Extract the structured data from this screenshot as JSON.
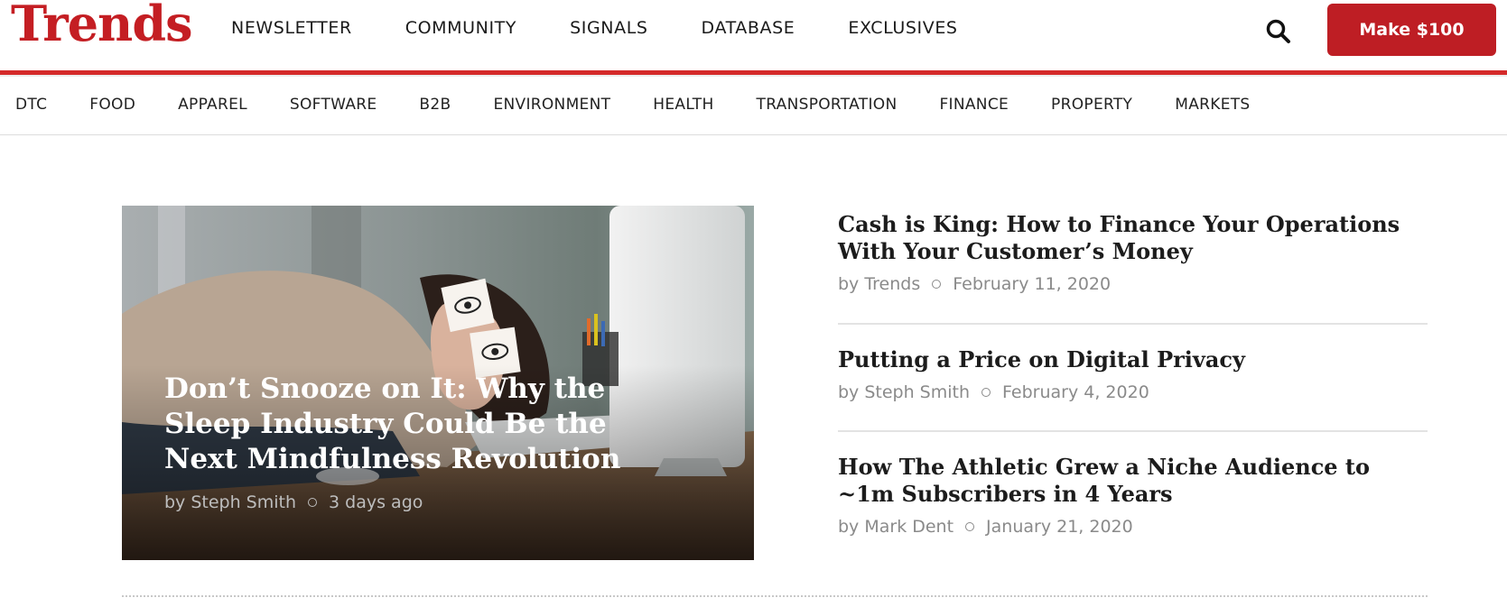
{
  "brand": {
    "name": "Trends",
    "color": "#c41e23"
  },
  "main_nav": [
    "NEWSLETTER",
    "COMMUNITY",
    "SIGNALS",
    "DATABASE",
    "EXCLUSIVES"
  ],
  "search": {
    "icon": "search-icon"
  },
  "cta": {
    "label": "Make $100",
    "color": "#be1e24"
  },
  "sub_nav": [
    "DTC",
    "FOOD",
    "APPAREL",
    "SOFTWARE",
    "B2B",
    "ENVIRONMENT",
    "HEALTH",
    "TRANSPORTATION",
    "FINANCE",
    "PROPERTY",
    "MARKETS"
  ],
  "featured": {
    "title": "Don’t Snooze on It: Why the Sleep Industry Could Be the Next Mindfulness Revolution",
    "author": "by Steph Smith",
    "date": "3 days ago"
  },
  "articles": [
    {
      "title": "Cash is King: How to Finance Your Operations With Your Customer’s Money",
      "author": "by Trends",
      "date": "February 11, 2020"
    },
    {
      "title": "Putting a Price on Digital Privacy",
      "author": "by Steph Smith",
      "date": "February 4, 2020"
    },
    {
      "title": "How The Athletic Grew a Niche Audience to ~1m Subscribers in 4 Years",
      "author": "by Mark Dent",
      "date": "January 21, 2020"
    }
  ]
}
